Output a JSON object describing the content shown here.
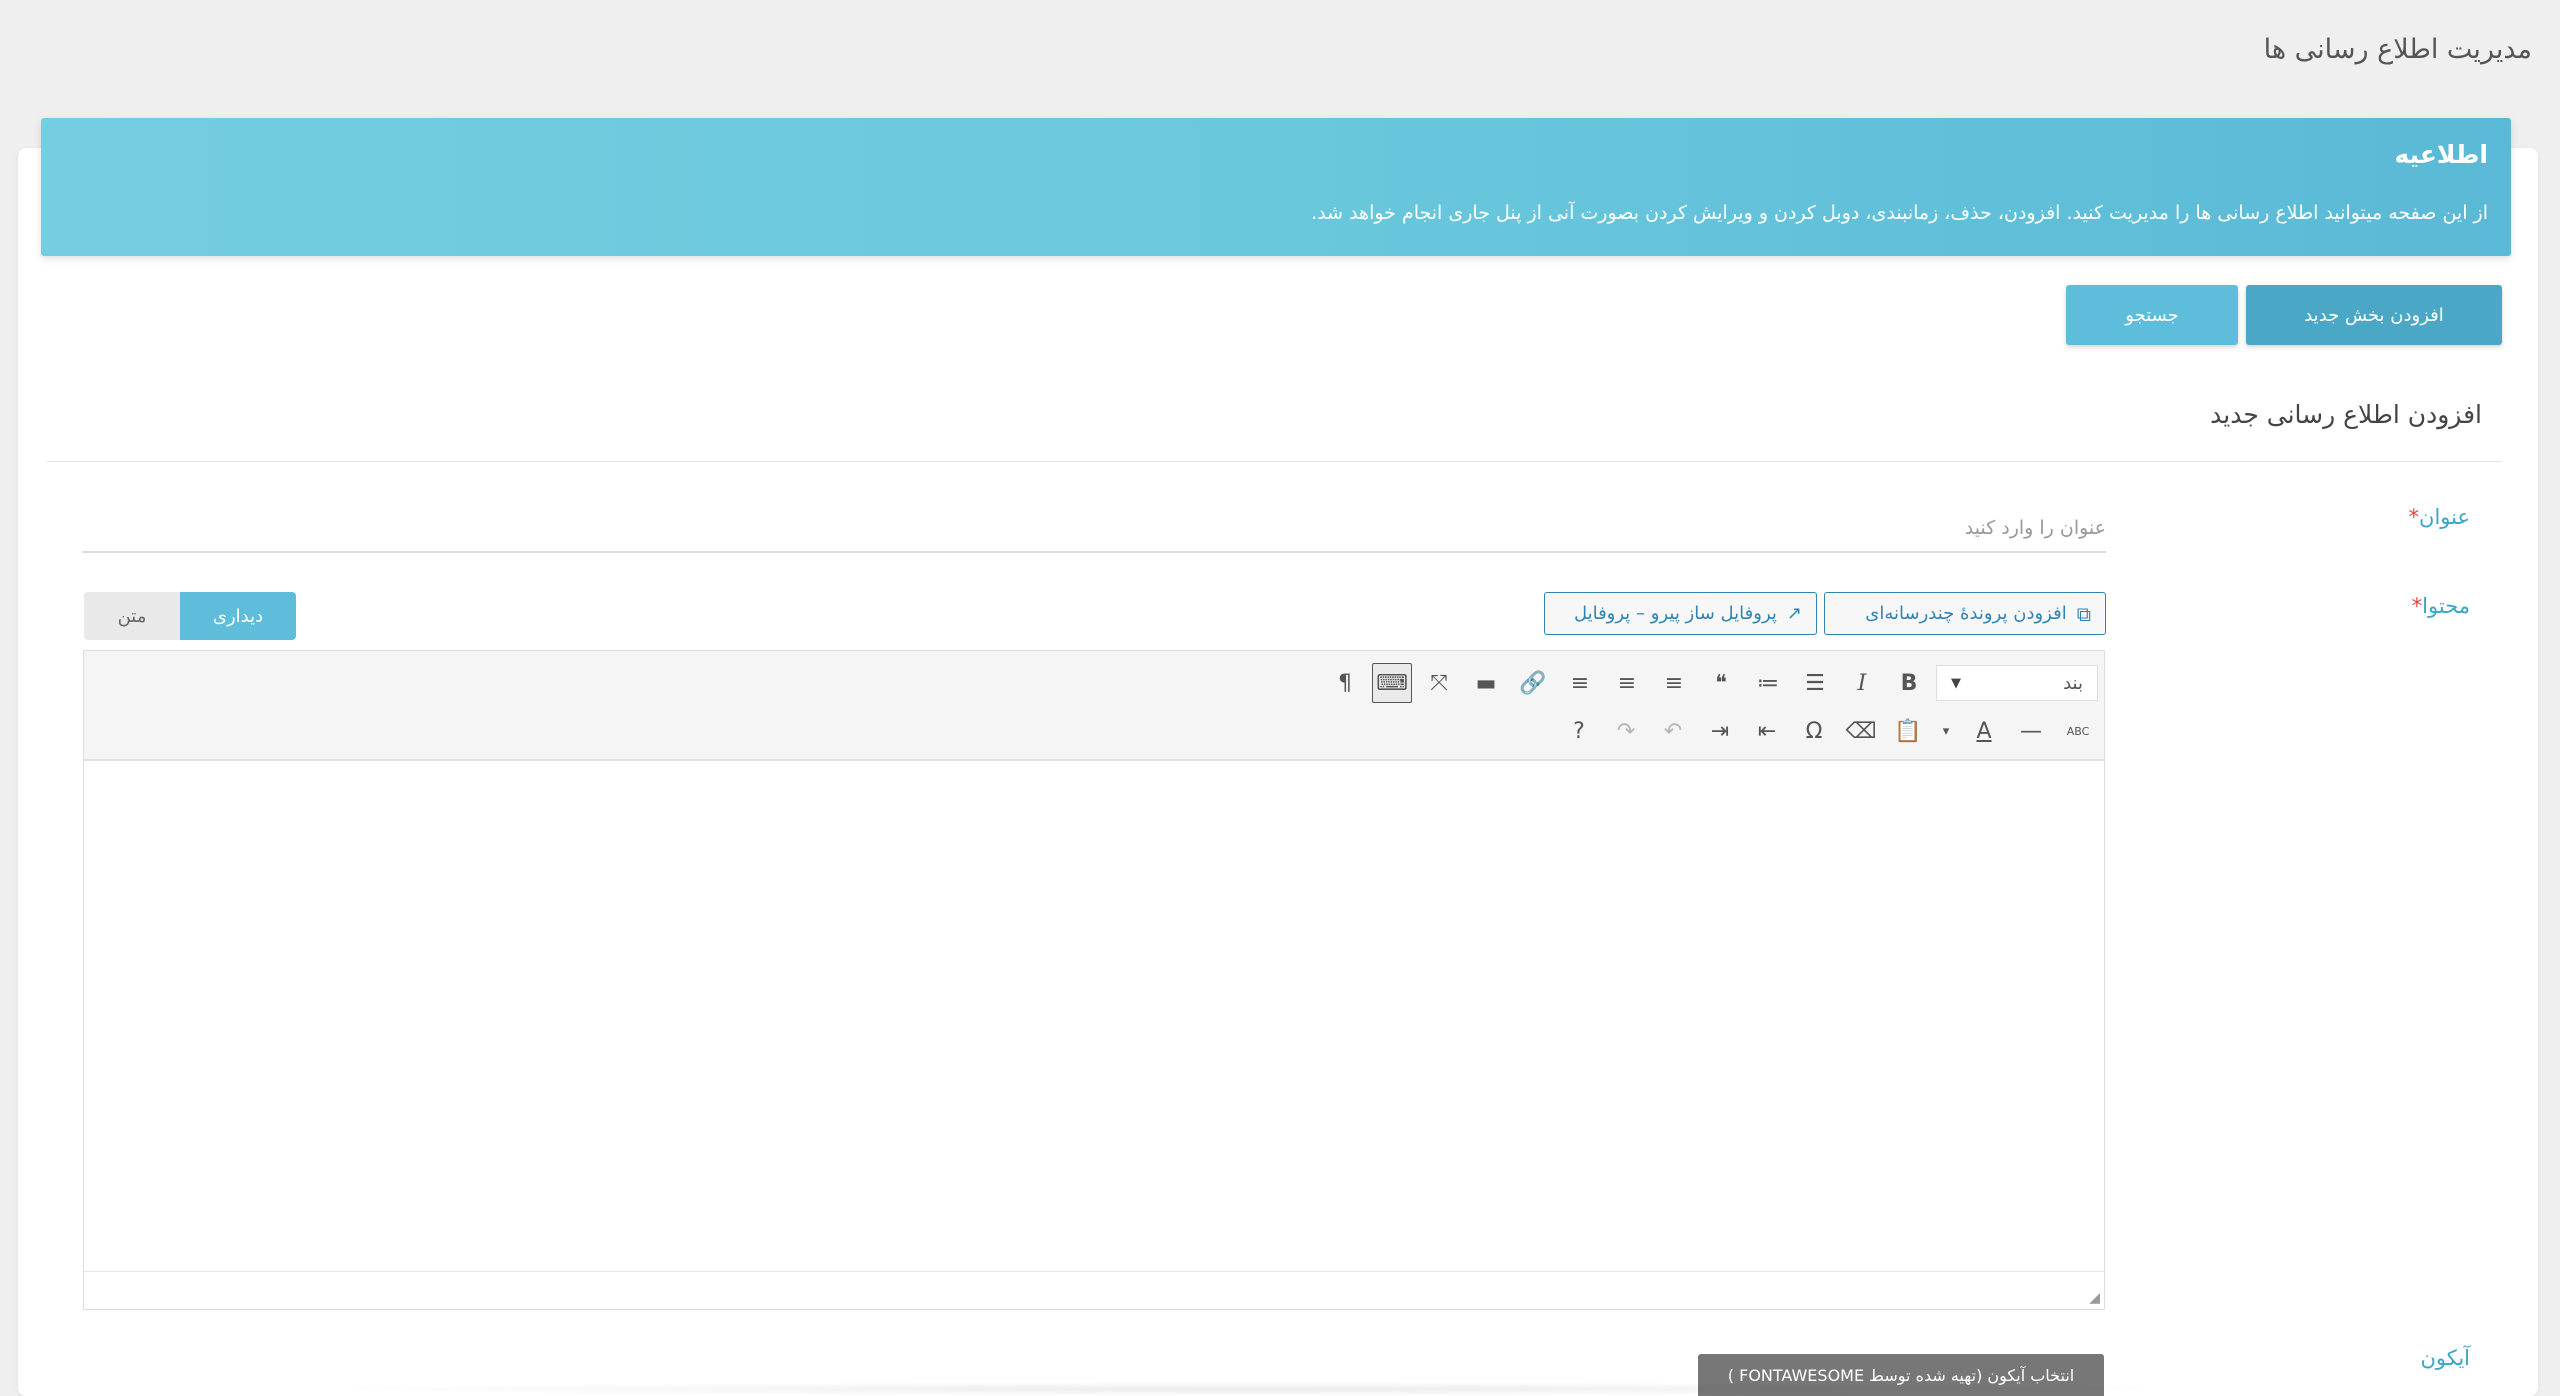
{
  "page": {
    "title": "مدیریت اطلاع رسانی ها"
  },
  "alert": {
    "title": "اطلاعیه",
    "text": "از این صفحه میتوانید اطلاع رسانی ها را مدیریت کنید. افزودن، حذف، زمانبندی، دوبل کردن و ویرایش کردن بصورت آنی از پنل جاری انجام خواهد شد."
  },
  "actions": {
    "add_label": "افزودن بخش جدید",
    "search_label": "جستجو"
  },
  "form": {
    "section_title": "افزودن اطلاع رسانی جدید",
    "required_mark": "*",
    "title_label": "عنوان",
    "title_placeholder": "عنوان را وارد کنید",
    "title_value": "",
    "content_label": "محتوا",
    "icon_label": "آیکون",
    "icon_button": "انتخاب آیکون (تهیه شده توسط FONTAWESOME )"
  },
  "editor": {
    "add_media_label": "افزودن پروندهٔ چندرسانه‌ای",
    "profile_label": "پروفایل ساز پیرو – پروفایل",
    "tab_visual": "دیداری",
    "tab_text": "متن",
    "format_select": "بند",
    "toolbar_row1": [
      {
        "name": "bold-icon",
        "glyph": "B"
      },
      {
        "name": "italic-icon",
        "glyph": "I"
      },
      {
        "name": "bullet-list-icon",
        "glyph": "☰"
      },
      {
        "name": "numbered-list-icon",
        "glyph": "≔"
      },
      {
        "name": "blockquote-icon",
        "glyph": "❝"
      },
      {
        "name": "align-left-icon",
        "glyph": "≡"
      },
      {
        "name": "align-center-icon",
        "glyph": "≡"
      },
      {
        "name": "align-right-icon",
        "glyph": "≡"
      },
      {
        "name": "link-icon",
        "glyph": "🔗"
      },
      {
        "name": "read-more-icon",
        "glyph": "▬"
      },
      {
        "name": "fullscreen-icon",
        "glyph": "⤧"
      },
      {
        "name": "keyboard-icon",
        "glyph": "⌨"
      },
      {
        "name": "rtl-paragraph-icon",
        "glyph": "¶"
      }
    ],
    "toolbar_row2": [
      {
        "name": "strikethrough-icon",
        "glyph": "ABC"
      },
      {
        "name": "horizontal-line-icon",
        "glyph": "—"
      },
      {
        "name": "text-color-icon",
        "glyph": "A"
      },
      {
        "name": "text-color-dropdown-icon",
        "glyph": "▾"
      },
      {
        "name": "paste-text-icon",
        "glyph": "📋"
      },
      {
        "name": "clear-formatting-icon",
        "glyph": "⌫"
      },
      {
        "name": "special-character-icon",
        "glyph": "Ω"
      },
      {
        "name": "outdent-icon",
        "glyph": "⇤"
      },
      {
        "name": "indent-icon",
        "glyph": "⇥"
      },
      {
        "name": "undo-icon",
        "glyph": "↶"
      },
      {
        "name": "redo-icon",
        "glyph": "↷"
      },
      {
        "name": "help-icon",
        "glyph": "?"
      }
    ]
  }
}
